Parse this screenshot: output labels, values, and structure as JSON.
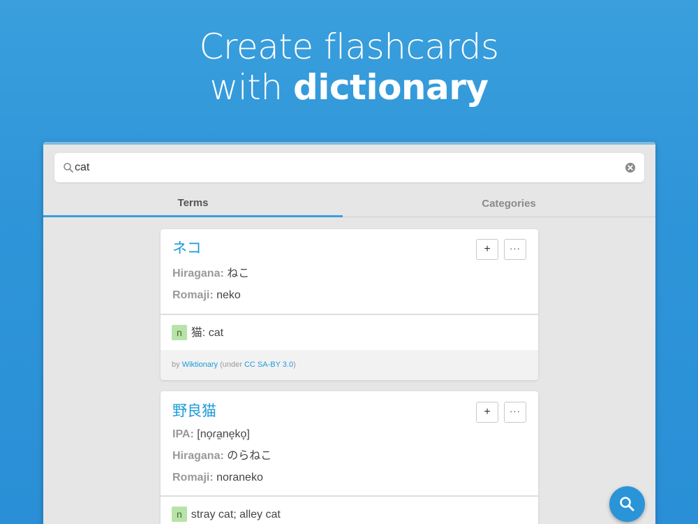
{
  "headline": {
    "line1": "Create flashcards",
    "line2_prefix": "with ",
    "line2_strong": "dictionary"
  },
  "search": {
    "value": "cat",
    "icon": "search-icon",
    "clear_icon": "clear-icon"
  },
  "tabs": [
    {
      "label": "Terms",
      "active": true
    },
    {
      "label": "Categories",
      "active": false
    }
  ],
  "results": [
    {
      "term": "ネコ",
      "fields": [
        {
          "label": "Hiragana:",
          "value": "ねこ"
        },
        {
          "label": "Romaji:",
          "value": "neko"
        }
      ],
      "meaning": {
        "pos": "n",
        "text": "猫: cat"
      },
      "attribution": {
        "by": "by ",
        "source": "Wiktionary",
        "under": " (under ",
        "license": "CC SA-BY 3.0",
        "close": ")"
      },
      "add_label": "+",
      "more_label": "···"
    },
    {
      "term": "野良猫",
      "fields": [
        {
          "label": "IPA:",
          "value": "[no̞ɾa̠ne̞ko̞]"
        },
        {
          "label": "Hiragana:",
          "value": "のらねこ"
        },
        {
          "label": "Romaji:",
          "value": "noraneko"
        }
      ],
      "meaning": {
        "pos": "n",
        "text": "stray cat; alley cat"
      },
      "add_label": "+",
      "more_label": "···"
    }
  ],
  "colors": {
    "background": "#3a9fdc",
    "accent": "#1b9bd8",
    "badge": "#b8e3a8"
  }
}
